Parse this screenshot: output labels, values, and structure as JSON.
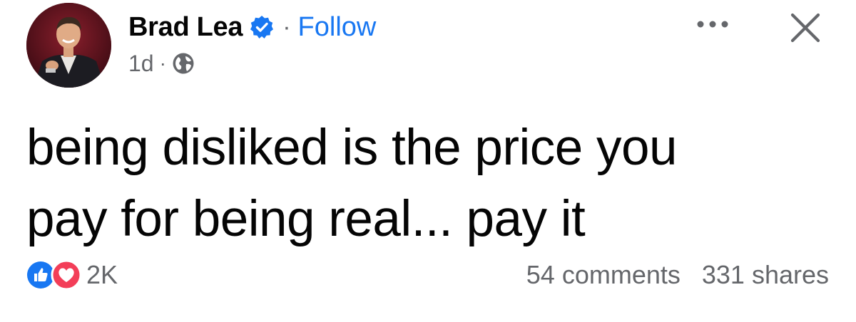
{
  "post": {
    "author_name": "Brad Lea",
    "follow_separator": "·",
    "follow_label": "Follow",
    "time_label": "1d",
    "meta_separator": "·",
    "audience_icon": "globe-icon",
    "text_line1": "being disliked is the price you",
    "text_line2": "pay for being real... pay it"
  },
  "footer": {
    "reaction_count": "2K",
    "comments_label": "54 comments",
    "shares_label": "331 shares"
  },
  "colors": {
    "brand_blue": "#1877f2",
    "secondary_text": "#65676b",
    "love_red": "#f33e58"
  }
}
